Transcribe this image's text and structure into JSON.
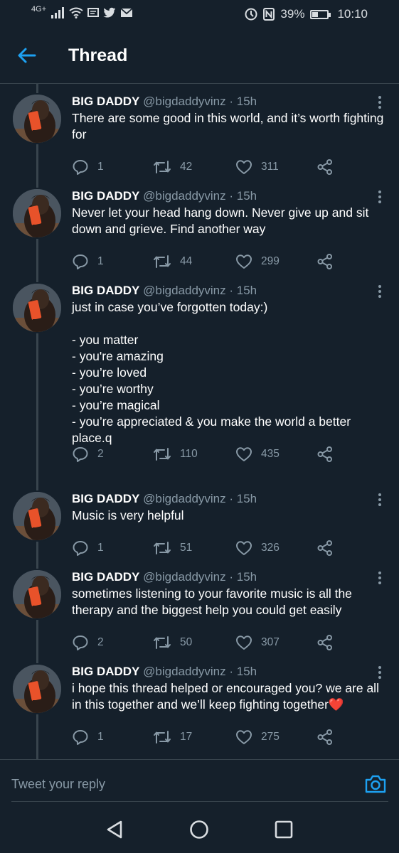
{
  "status": {
    "network": "4G",
    "network_sup": "+",
    "battery_percent": "39%",
    "battery_level": 0.39,
    "time": "10:10",
    "left_icons": [
      "signal-icon",
      "wifi-icon",
      "message-icon",
      "twitter-bird-icon",
      "mail-icon"
    ],
    "right_icons": [
      "data-saver-icon",
      "nfc-icon",
      "battery-icon"
    ]
  },
  "header": {
    "title": "Thread"
  },
  "accent_color": "#1da1f2",
  "tweets": [
    {
      "name": "BIG DADDY",
      "meta": "@bigdaddyvinz · 15h",
      "text": "There are some good in this world, and it’s worth fighting for",
      "replies": "1",
      "retweets": "42",
      "likes": "311"
    },
    {
      "name": "BIG DADDY",
      "meta": "@bigdaddyvinz · 15h",
      "text": "Never let your head hang down. Never give up and sit down and grieve. Find another way",
      "replies": "1",
      "retweets": "44",
      "likes": "299"
    },
    {
      "name": "BIG DADDY",
      "meta": "@bigdaddyvinz · 15h",
      "text": "just in case you’ve forgotten today:)\n\n- you matter\n- you're amazing\n- you’re loved\n- you’re worthy\n- you’re magical\n- you’re appreciated & you make the world a better place.q",
      "replies": "2",
      "retweets": "110",
      "likes": "435"
    },
    {
      "name": "BIG DADDY",
      "meta": "@bigdaddyvinz · 15h",
      "text": "Music is very helpful",
      "replies": "1",
      "retweets": "51",
      "likes": "326"
    },
    {
      "name": "BIG DADDY",
      "meta": "@bigdaddyvinz · 15h",
      "text": "sometimes listening to your favorite music is all the therapy and the biggest help you could get easily",
      "replies": "2",
      "retweets": "50",
      "likes": "307"
    },
    {
      "name": "BIG DADDY",
      "meta": "@bigdaddyvinz · 15h",
      "text": "i hope this thread helped or encouraged you? we are all in this together and we’ll keep fighting together❤️",
      "replies": "1",
      "retweets": "17",
      "likes": "275"
    }
  ],
  "reply_bar": {
    "placeholder": "Tweet your reply"
  }
}
